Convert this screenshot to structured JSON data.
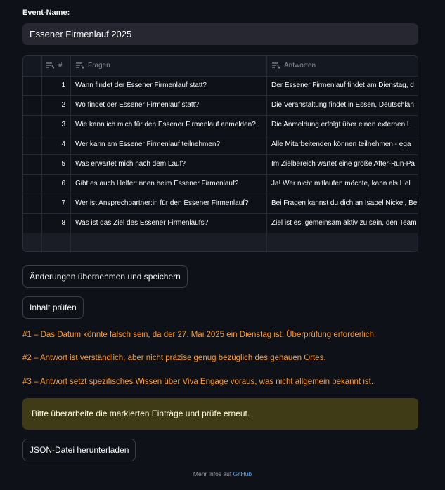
{
  "event": {
    "label": "Event-Name:",
    "value": "Essener Firmenlauf 2025"
  },
  "table": {
    "columns": [
      "#",
      "Fragen",
      "Antworten"
    ],
    "rows": [
      {
        "idx": "1",
        "q": "Wann findet der Essener Firmenlauf statt?",
        "a": "Der Essener Firmenlauf findet am Dienstag, d"
      },
      {
        "idx": "2",
        "q": "Wo findet der Essener Firmenlauf statt?",
        "a": "Die Veranstaltung findet in Essen, Deutschlan"
      },
      {
        "idx": "3",
        "q": "Wie kann ich mich für den Essener Firmenlauf anmelden?",
        "a": "Die Anmeldung erfolgt über einen externen L"
      },
      {
        "idx": "4",
        "q": "Wer kann am Essener Firmenlauf teilnehmen?",
        "a": "Alle Mitarbeitenden können teilnehmen - ega"
      },
      {
        "idx": "5",
        "q": "Was erwartet mich nach dem Lauf?",
        "a": "Im Zielbereich wartet eine große After-Run-Pa"
      },
      {
        "idx": "6",
        "q": "Gibt es auch Helfer:innen beim Essener Firmenlauf?",
        "a": "Ja! Wer nicht mitlaufen möchte, kann als Hel"
      },
      {
        "idx": "7",
        "q": "Wer ist Ansprechpartner:in für den Essener Firmenlauf?",
        "a": "Bei Fragen kannst du dich an Isabel Nickel, Be"
      },
      {
        "idx": "8",
        "q": "Was ist das Ziel des Essener Firmenlaufs?",
        "a": "Ziel ist es, gemeinsam aktiv zu sein, den Team"
      }
    ]
  },
  "buttons": {
    "save": "Änderungen übernehmen und speichern",
    "check": "Inhalt prüfen",
    "download": "JSON-Datei herunterladen"
  },
  "warnings": [
    "#1 – Das Datum könnte falsch sein, da der 27. Mai 2025 ein Dienstag ist. Überprüfung erforderlich.",
    "#2 – Antwort ist verständlich, aber nicht präzise genug bezüglich des genauen Ortes.",
    "#3 – Antwort setzt spezifisches Wissen über Viva Engage voraus, was nicht allgemein bekannt ist."
  ],
  "alert": "Bitte überarbeite die markierten Einträge und prüfe erneut.",
  "footer": {
    "text": "Mehr Infos auf",
    "link": "GitHub"
  },
  "colors": {
    "background": "#0e1117",
    "warning": "#ff9a2e",
    "alert_bg": "#3e3b16",
    "link": "#4aa8ff"
  }
}
